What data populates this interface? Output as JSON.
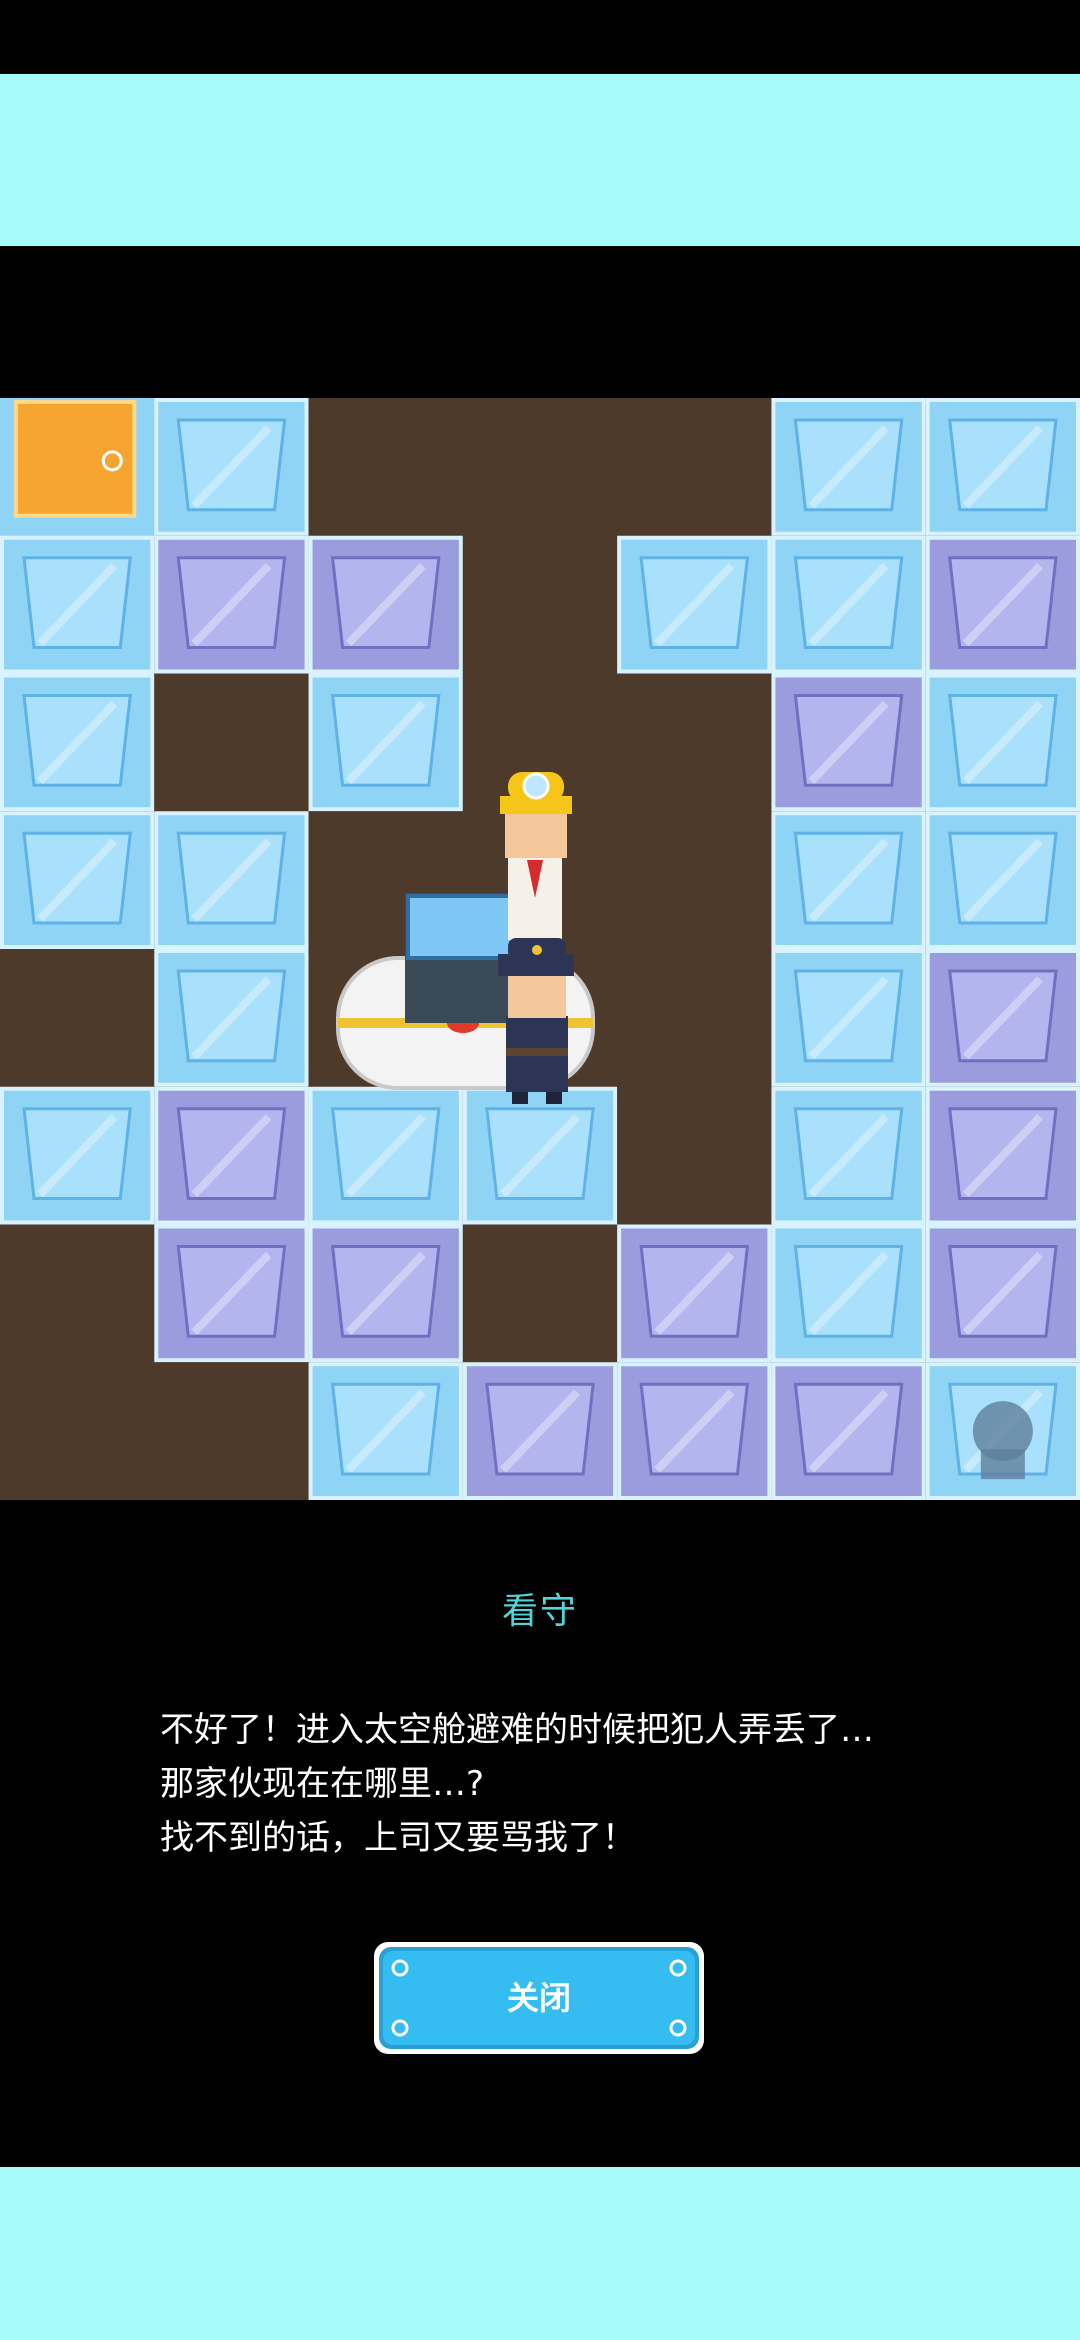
{
  "dialog": {
    "speaker": "看守",
    "lines": [
      "不好了！进入太空舱避难的时候把犯人弄丢了…",
      "那家伙现在在哪里…?",
      "找不到的话，上司又要骂我了！"
    ],
    "close_label": "关闭"
  },
  "board": {
    "grid": [
      [
        "exit",
        "ice",
        "dirt",
        "dirt",
        "dirt",
        "ice",
        "ice"
      ],
      [
        "ice",
        "purple",
        "purple",
        "dirt",
        "ice",
        "ice",
        "purple"
      ],
      [
        "ice",
        "dirt",
        "ice",
        "dirt",
        "dirt",
        "purple",
        "ice"
      ],
      [
        "ice",
        "ice",
        "dirt",
        "dirt",
        "dirt",
        "ice",
        "ice"
      ],
      [
        "dirt",
        "ice",
        "dirt",
        "dirt",
        "dirt",
        "ice",
        "purple"
      ],
      [
        "ice",
        "purple",
        "ice",
        "ice",
        "dirt",
        "ice",
        "purple"
      ],
      [
        "dirt",
        "purple",
        "purple",
        "dirt",
        "purple",
        "ice",
        "purple"
      ],
      [
        "dirt",
        "dirt",
        "ice",
        "purple",
        "purple",
        "purple",
        "frozen"
      ]
    ],
    "characters": [
      "miner-character",
      "guard-character"
    ],
    "props": [
      "escape-pod"
    ]
  },
  "colors": {
    "band": "#a6fbf8",
    "dirt": "#4d3a2a",
    "ice": "#8fd3f5",
    "ice_purple": "#9a9cde",
    "exit": "#f7a531",
    "speaker": "#55d4d8",
    "button": "#2fb6f0"
  }
}
